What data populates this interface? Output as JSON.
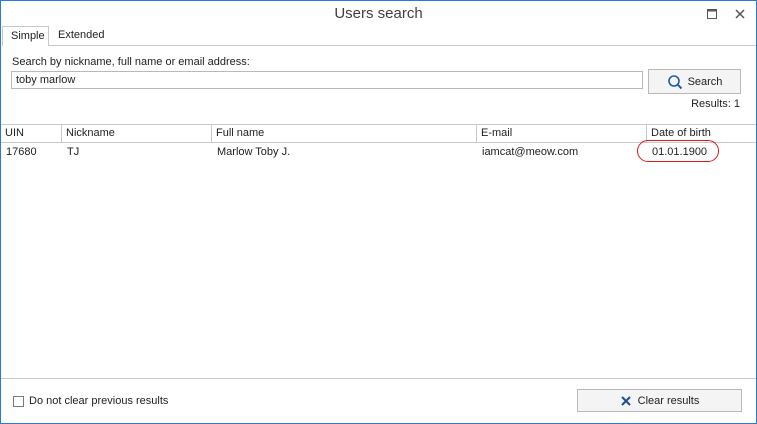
{
  "window": {
    "title": "Users search",
    "maximize_icon": "maximize-icon",
    "close_icon": "close-icon"
  },
  "tabs": [
    {
      "label": "Simple",
      "active": true
    },
    {
      "label": "Extended",
      "active": false
    }
  ],
  "search": {
    "label": "Search by nickname, full name or email address:",
    "value": "toby marlow",
    "button_label": "Search",
    "button_icon": "magnifier-icon",
    "results_text": "Results: 1"
  },
  "table": {
    "columns": [
      "UIN",
      "Nickname",
      "Full name",
      "E-mail",
      "Date of birth"
    ],
    "rows": [
      {
        "uin": "17680",
        "nickname": "TJ",
        "full_name": "Marlow Toby J.",
        "email": "iamcat@meow.com",
        "dob": "01.01.1900"
      }
    ]
  },
  "footer": {
    "checkbox_label": "Do not clear previous results",
    "checkbox_checked": false,
    "clear_label": "Clear results",
    "clear_icon": "x-icon"
  },
  "colors": {
    "accent": "#2b79d6",
    "highlight": "#e01818",
    "border": "#c9c9c9"
  }
}
